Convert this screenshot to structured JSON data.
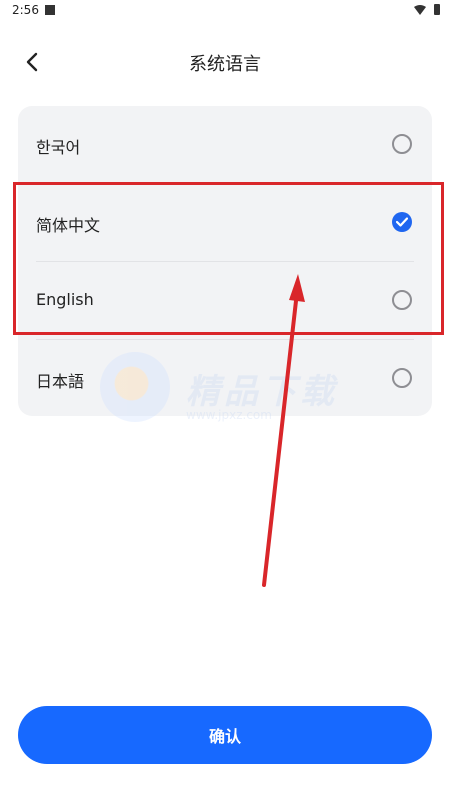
{
  "status_bar": {
    "time": "2:56"
  },
  "header": {
    "back_icon": "chevron-left-icon",
    "title": "系统语言"
  },
  "languages": [
    {
      "label": "한국어",
      "selected": false
    },
    {
      "label": "简体中文",
      "selected": true
    },
    {
      "label": "English",
      "selected": false
    },
    {
      "label": "日本語",
      "selected": false
    }
  ],
  "watermark": {
    "text": "精品下载",
    "url": "www.jpxz.com"
  },
  "confirm_button": {
    "label": "确认"
  },
  "colors": {
    "accent": "#1769ff",
    "radio_checked": "#1f66f0",
    "annotation_red": "#d9262a",
    "card_bg": "#f2f3f5"
  }
}
